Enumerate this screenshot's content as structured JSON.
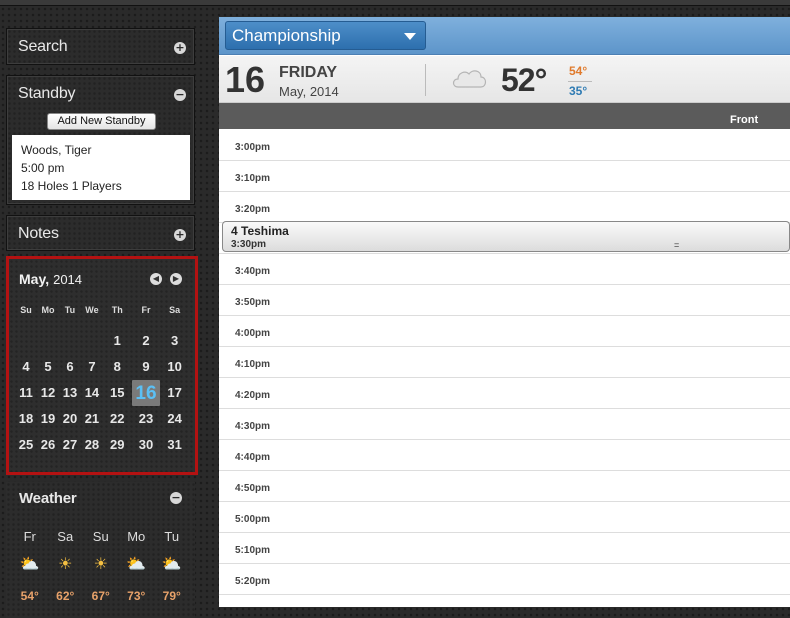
{
  "sidebar": {
    "search": {
      "title": "Search",
      "toggle": "+"
    },
    "standby": {
      "title": "Standby",
      "toggle": "−",
      "add_button": "Add New Standby",
      "entry": {
        "name": "Woods, Tiger",
        "time": "5:00 pm",
        "details": "18 Holes 1 Players"
      }
    },
    "notes": {
      "title": "Notes",
      "toggle": "+"
    },
    "calendar": {
      "month": "May,",
      "year": "2014",
      "prev": "◀",
      "next": "▶",
      "weekdays": [
        "Su",
        "Mo",
        "Tu",
        "We",
        "Th",
        "Fr",
        "Sa"
      ],
      "weeks": [
        [
          "",
          "",
          "",
          "",
          "1",
          "2",
          "3"
        ],
        [
          "4",
          "5",
          "6",
          "7",
          "8",
          "9",
          "10"
        ],
        [
          "11",
          "12",
          "13",
          "14",
          "15",
          "16",
          "17"
        ],
        [
          "18",
          "19",
          "20",
          "21",
          "22",
          "23",
          "24"
        ],
        [
          "25",
          "26",
          "27",
          "28",
          "29",
          "30",
          "31"
        ]
      ],
      "today": "16"
    },
    "weather": {
      "title": "Weather",
      "toggle": "−",
      "days": [
        "Fr",
        "Sa",
        "Su",
        "Mo",
        "Tu"
      ],
      "icons": [
        "partly-cloudy-icon",
        "sun-icon",
        "sun-icon",
        "partly-cloudy-icon",
        "partly-cloudy-icon"
      ],
      "temps": [
        "54°",
        "62°",
        "67°",
        "73°",
        "79°"
      ]
    }
  },
  "main": {
    "course": "Championship",
    "date": {
      "day_num": "16",
      "weekday": "FRIDAY",
      "month_year": "May, 2014"
    },
    "weather": {
      "icon": "cloud-icon",
      "temp": "52°",
      "high": "54°",
      "low": "35°"
    },
    "column": "Front",
    "slots": [
      "3:00pm",
      "3:10pm",
      "3:20pm",
      "3:30pm",
      "3:40pm",
      "3:50pm",
      "4:00pm",
      "4:10pm",
      "4:20pm",
      "4:30pm",
      "4:40pm",
      "4:50pm",
      "5:00pm",
      "5:10pm",
      "5:20pm"
    ],
    "booking": {
      "name": "4 Teshima",
      "time": "3:30pm",
      "handle": "="
    }
  },
  "colors": {
    "accent_blue": "#3a7dbf",
    "calendar_highlight": "#b31212",
    "today_text": "#5bc0f5",
    "temp_high": "#e07a2c",
    "temp_low": "#2f7bb3"
  }
}
